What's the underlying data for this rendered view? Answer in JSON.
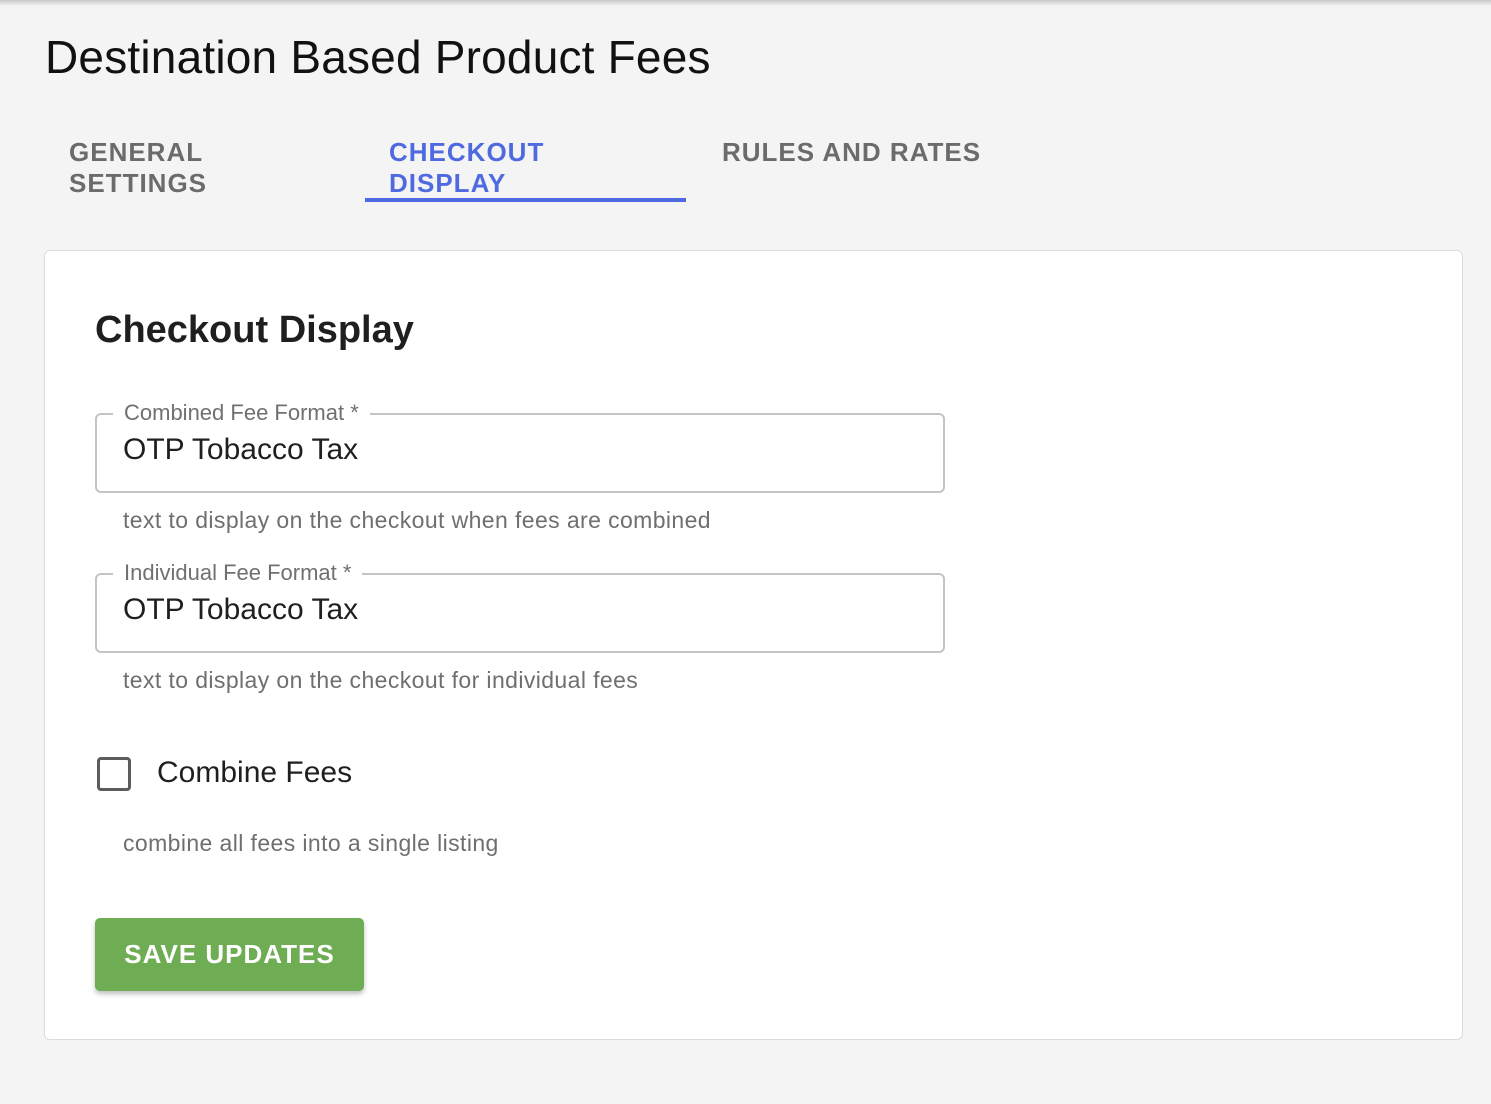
{
  "page": {
    "title": "Destination Based Product Fees"
  },
  "tabs": [
    {
      "label": "GENERAL SETTINGS",
      "active": false
    },
    {
      "label": "CHECKOUT DISPLAY",
      "active": true
    },
    {
      "label": "RULES AND RATES",
      "active": false
    }
  ],
  "card": {
    "title": "Checkout Display",
    "combined_fee": {
      "label": "Combined Fee Format *",
      "value": "OTP Tobacco Tax",
      "helper": "text to display on the checkout when fees are combined"
    },
    "individual_fee": {
      "label": "Individual Fee Format *",
      "value": "OTP Tobacco Tax",
      "helper": "text to display on the checkout for individual fees"
    },
    "combine_fees": {
      "label": "Combine Fees",
      "checked": false,
      "helper": "combine all fees into a single listing"
    },
    "save_label": "SAVE UPDATES"
  },
  "colors": {
    "accent": "#4f6ae0",
    "save_button": "#6fad54",
    "background": "#f4f4f4"
  }
}
